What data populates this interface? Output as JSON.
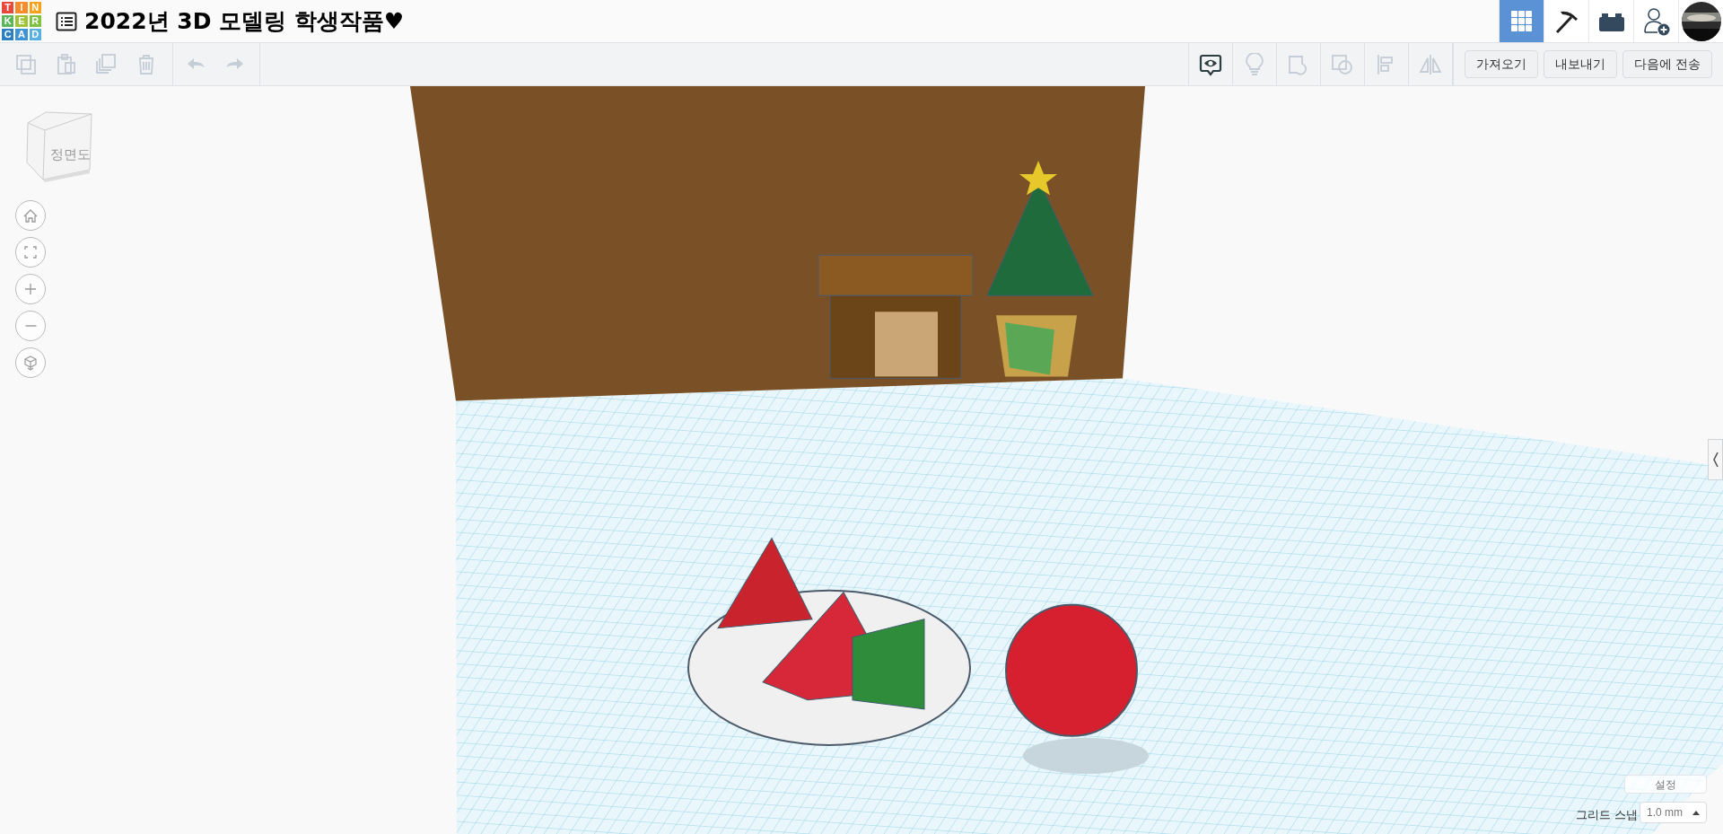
{
  "logo": {
    "letters": [
      "T",
      "I",
      "N",
      "K",
      "E",
      "R",
      "C",
      "A",
      "D"
    ]
  },
  "title": "2022년 3D 모델링 학생작품♥",
  "nav": [
    {
      "kind": "grid",
      "selected": true
    },
    {
      "kind": "pickaxe",
      "selected": false
    },
    {
      "kind": "brick",
      "selected": false
    },
    {
      "kind": "user-add",
      "selected": false
    },
    {
      "kind": "avatar",
      "selected": false
    }
  ],
  "edit_tools": [
    {
      "kind": "copy",
      "disabled": true
    },
    {
      "kind": "paste",
      "disabled": true
    },
    {
      "kind": "duplicate",
      "disabled": true
    },
    {
      "kind": "delete",
      "disabled": true
    }
  ],
  "history_tools": [
    {
      "kind": "undo",
      "disabled": true
    },
    {
      "kind": "redo",
      "disabled": true
    }
  ],
  "view_tools": [
    {
      "kind": "notes",
      "disabled": false
    },
    {
      "kind": "bulb",
      "disabled": true
    },
    {
      "kind": "shape",
      "disabled": true
    },
    {
      "kind": "group",
      "disabled": true
    },
    {
      "kind": "align",
      "disabled": true
    },
    {
      "kind": "mirror",
      "disabled": true
    }
  ],
  "actions": [
    "가져오기",
    "내보내기",
    "다음에 전송"
  ],
  "view_cube": {
    "front": "정면도"
  },
  "view_controls": [
    {
      "kind": "home"
    },
    {
      "kind": "fit"
    },
    {
      "kind": "zoom-in"
    },
    {
      "kind": "zoom-out"
    },
    {
      "kind": "perspective"
    }
  ],
  "scene": {
    "kind": "picture"
  },
  "settings": {
    "button": "설정",
    "grid_snap_label": "그리드 스냅",
    "grid_snap_value": "1.0 mm"
  }
}
